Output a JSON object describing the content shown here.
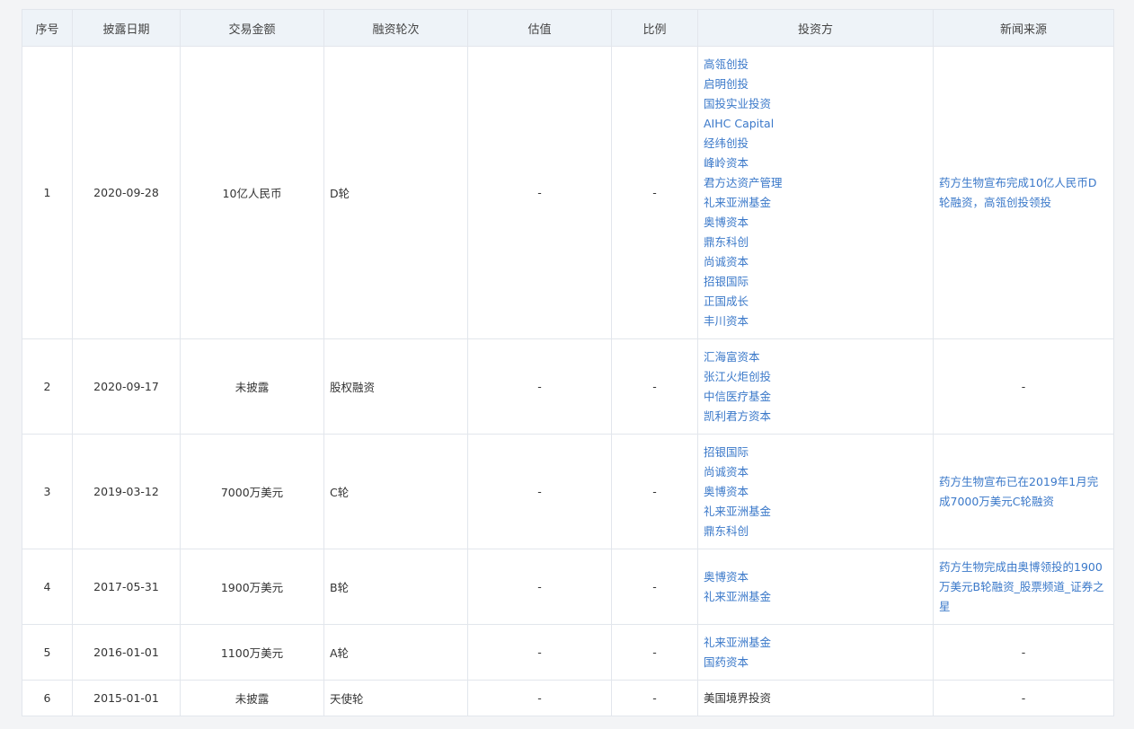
{
  "table": {
    "headers": [
      "序号",
      "披露日期",
      "交易金额",
      "融资轮次",
      "估值",
      "比例",
      "投资方",
      "新闻来源"
    ],
    "rows": [
      {
        "no": "1",
        "date": "2020-09-28",
        "amount": "10亿人民币",
        "round": "D轮",
        "valuation": "-",
        "ratio": "-",
        "investors": [
          "高瓴创投",
          "启明创投",
          "国投实业投资",
          "AIHC Capital",
          "经纬创投",
          "峰岭资本",
          "君方达资产管理",
          "礼来亚洲基金",
          "奥博资本",
          "鼎东科创",
          "尚诚资本",
          "招银国际",
          "正国成长",
          "丰川资本"
        ],
        "news": "药方生物宣布完成10亿人民币D轮融资，高瓴创投领投"
      },
      {
        "no": "2",
        "date": "2020-09-17",
        "amount": "未披露",
        "round": "股权融资",
        "valuation": "-",
        "ratio": "-",
        "investors": [
          "汇海富资本",
          "张江火炬创投",
          "中信医疗基金",
          "凯利君方资本"
        ],
        "news": "-"
      },
      {
        "no": "3",
        "date": "2019-03-12",
        "amount": "7000万美元",
        "round": "C轮",
        "valuation": "-",
        "ratio": "-",
        "investors": [
          "招银国际",
          "尚诚资本",
          "奥博资本",
          "礼来亚洲基金",
          "鼎东科创"
        ],
        "news": "药方生物宣布已在2019年1月完成7000万美元C轮融资"
      },
      {
        "no": "4",
        "date": "2017-05-31",
        "amount": "1900万美元",
        "round": "B轮",
        "valuation": "-",
        "ratio": "-",
        "investors": [
          "奥博资本",
          "礼来亚洲基金"
        ],
        "news": "药方生物完成由奥博领投的1900万美元B轮融资_股票频道_证券之星"
      },
      {
        "no": "5",
        "date": "2016-01-01",
        "amount": "1100万美元",
        "round": "A轮",
        "valuation": "-",
        "ratio": "-",
        "investors": [
          "礼来亚洲基金",
          "国药资本"
        ],
        "news": "-"
      },
      {
        "no": "6",
        "date": "2015-01-01",
        "amount": "未披露",
        "round": "天使轮",
        "valuation": "-",
        "ratio": "-",
        "investors": [
          "美国境界投资"
        ],
        "investors_plain": true,
        "news": "-"
      }
    ]
  },
  "colors": {
    "link": "#3a78c9",
    "header_bg": "#eef3f8",
    "border": "#e2e6ec",
    "page_bg": "#f3f4f6"
  }
}
